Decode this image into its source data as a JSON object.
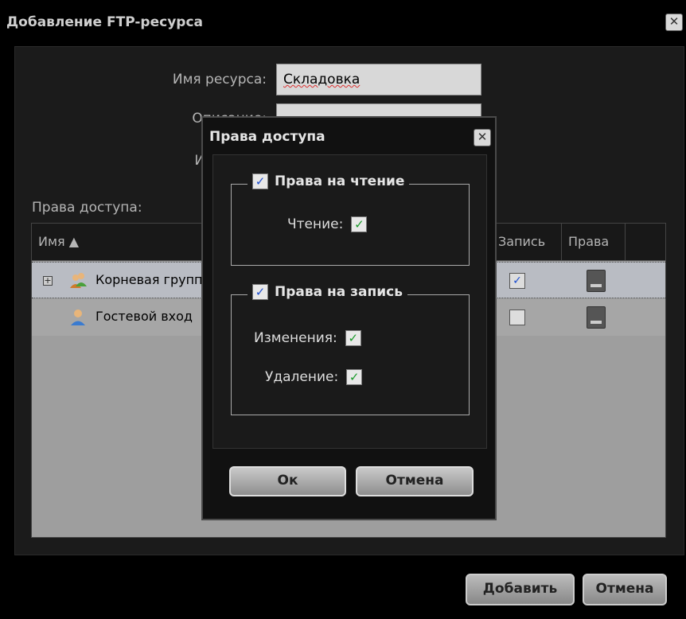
{
  "window": {
    "title": "Добавление FTP-ресурса"
  },
  "form": {
    "name_label": "Имя ресурса:",
    "name_value": "Складовка",
    "description_label": "Описание:",
    "source_label": "Источник:"
  },
  "grid": {
    "label": "Права доступа:",
    "columns": [
      "Имя ▲",
      "Запись",
      "Права"
    ],
    "rows": [
      {
        "name": "Корневая группа",
        "write_checked": true
      },
      {
        "name": "Гостевой вход",
        "write_checked": false
      }
    ]
  },
  "buttons": {
    "add": "Добавить",
    "cancel": "Отмена"
  },
  "modal": {
    "title": "Права доступа",
    "read_group": {
      "label": "Права на чтение",
      "checked": true,
      "read_label": "Чтение:",
      "read_checked": true
    },
    "write_group": {
      "label": "Права на запись",
      "checked": true,
      "modify_label": "Изменения:",
      "modify_checked": true,
      "delete_label": "Удаление:",
      "delete_checked": true
    },
    "ok": "Ок",
    "cancel": "Отмена"
  },
  "colors": {
    "checkbox_check": "#1e4fd0",
    "perm_check": "#1a9a2a"
  }
}
